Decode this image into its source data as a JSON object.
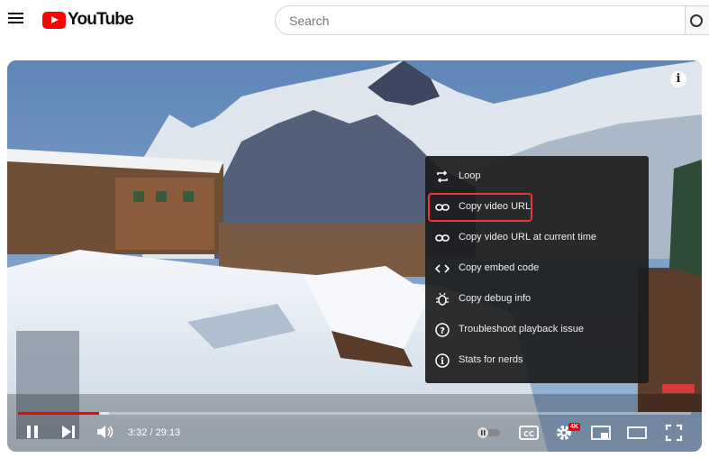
{
  "header": {
    "logo_text": "YouTube",
    "search_placeholder": "Search"
  },
  "player": {
    "time_display": "3:32 / 29:13",
    "progress_fraction": 0.121,
    "buffer_fraction": 0.135,
    "quality_badge": "4K"
  },
  "context_menu": {
    "items": [
      {
        "label": "Loop",
        "icon": "loop-icon"
      },
      {
        "label": "Copy video URL",
        "icon": "link-icon",
        "selected": true
      },
      {
        "label": "Copy video URL at current time",
        "icon": "link-icon"
      },
      {
        "label": "Copy embed code",
        "icon": "code-icon"
      },
      {
        "label": "Copy debug info",
        "icon": "bug-icon"
      },
      {
        "label": "Troubleshoot playback issue",
        "icon": "question-icon"
      },
      {
        "label": "Stats for nerds",
        "icon": "info-icon"
      }
    ]
  },
  "colors": {
    "brand_red": "#ff0000",
    "selection_outline": "#e53935",
    "progress": "#ff0000"
  }
}
